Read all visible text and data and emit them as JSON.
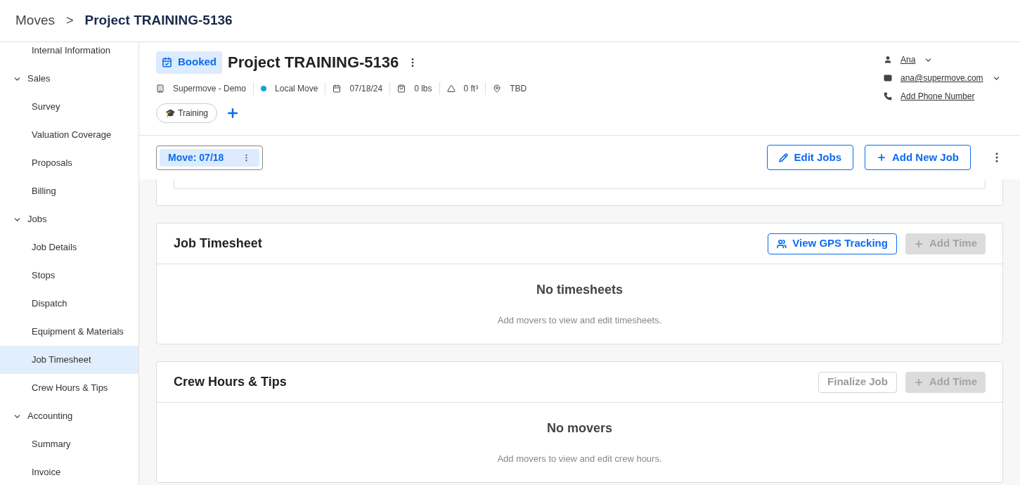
{
  "breadcrumb": {
    "parent": "Moves",
    "separator": ">",
    "current": "Project TRAINING-5136"
  },
  "sidebar": {
    "items": [
      {
        "kind": "link",
        "label": "Internal Information",
        "selected": false
      },
      {
        "kind": "group",
        "label": "Sales",
        "expanded": true,
        "children": [
          {
            "label": "Survey",
            "selected": false
          },
          {
            "label": "Valuation Coverage",
            "selected": false
          },
          {
            "label": "Proposals",
            "selected": false
          },
          {
            "label": "Billing",
            "selected": false
          }
        ]
      },
      {
        "kind": "group",
        "label": "Jobs",
        "expanded": true,
        "children": [
          {
            "label": "Job Details",
            "selected": false
          },
          {
            "label": "Stops",
            "selected": false
          },
          {
            "label": "Dispatch",
            "selected": false
          },
          {
            "label": "Equipment & Materials",
            "selected": false
          },
          {
            "label": "Job Timesheet",
            "selected": true
          },
          {
            "label": "Crew Hours & Tips",
            "selected": false
          }
        ]
      },
      {
        "kind": "group",
        "label": "Accounting",
        "expanded": true,
        "children": [
          {
            "label": "Summary",
            "selected": false
          },
          {
            "label": "Invoice",
            "selected": false
          }
        ]
      }
    ]
  },
  "project": {
    "status": "Booked",
    "title": "Project TRAINING-5136",
    "meta": [
      {
        "kind": "building",
        "text": "Supermove - Demo"
      },
      {
        "kind": "dot",
        "text": "Local Move",
        "color": "#0ea5d9"
      },
      {
        "kind": "calendar",
        "text": "07/18/24"
      },
      {
        "kind": "weight",
        "text": "0 lbs"
      },
      {
        "kind": "volume",
        "text": "0 ft³"
      },
      {
        "kind": "pin",
        "text": "TBD"
      }
    ],
    "tags": [
      {
        "emoji": "🎓",
        "label": "Training"
      }
    ]
  },
  "contact": [
    {
      "kind": "person",
      "text": "Ana",
      "dropdown": true
    },
    {
      "kind": "email",
      "text": "ana@supermove.com",
      "dropdown": true
    },
    {
      "kind": "phone",
      "text": "Add Phone Number",
      "dropdown": false
    }
  ],
  "job_tabs": [
    {
      "label": "Move: 07/18",
      "selected": true
    }
  ],
  "toolbar": [
    {
      "kind": "edit",
      "label": "Edit Jobs"
    },
    {
      "kind": "add",
      "label": "Add New Job"
    }
  ],
  "cards": [
    {
      "title": "Job Timesheet",
      "buttons": [
        {
          "kind": "gps",
          "label": "View GPS Tracking",
          "disabled": false
        },
        {
          "kind": "add",
          "label": "Add Time",
          "disabled": true
        }
      ],
      "empty_title": "No timesheets",
      "empty_text": "Add movers to view and edit timesheets."
    },
    {
      "title": "Crew Hours & Tips",
      "buttons": [
        {
          "kind": "plain",
          "label": "Finalize Job",
          "disabled": true
        },
        {
          "kind": "add",
          "label": "Add Time",
          "disabled": true
        }
      ],
      "empty_title": "No movers",
      "empty_text": "Add movers to view and edit crew hours."
    }
  ]
}
